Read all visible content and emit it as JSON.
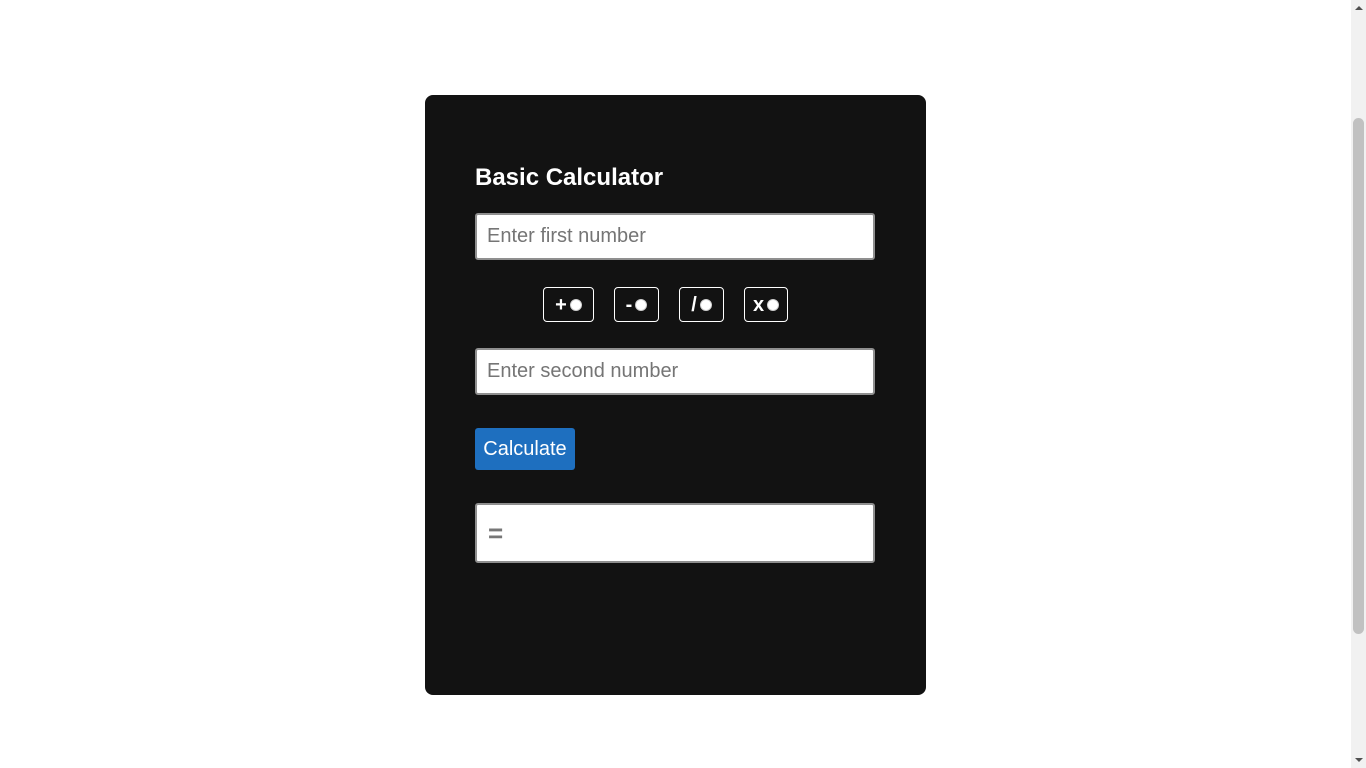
{
  "calculator": {
    "title": "Basic Calculator",
    "first_input": {
      "placeholder": "Enter first number",
      "value": ""
    },
    "operators": [
      {
        "symbol": "+",
        "name": "add",
        "selected": false
      },
      {
        "symbol": "-",
        "name": "subtract",
        "selected": false
      },
      {
        "symbol": "/",
        "name": "divide",
        "selected": false
      },
      {
        "symbol": "x",
        "name": "multiply",
        "selected": false
      }
    ],
    "second_input": {
      "placeholder": "Enter second number",
      "value": ""
    },
    "calculate_label": "Calculate",
    "result": {
      "equals": "=",
      "value": ""
    }
  },
  "colors": {
    "card_background": "#121212",
    "button_background": "#1e6fbf",
    "text": "#ffffff"
  }
}
